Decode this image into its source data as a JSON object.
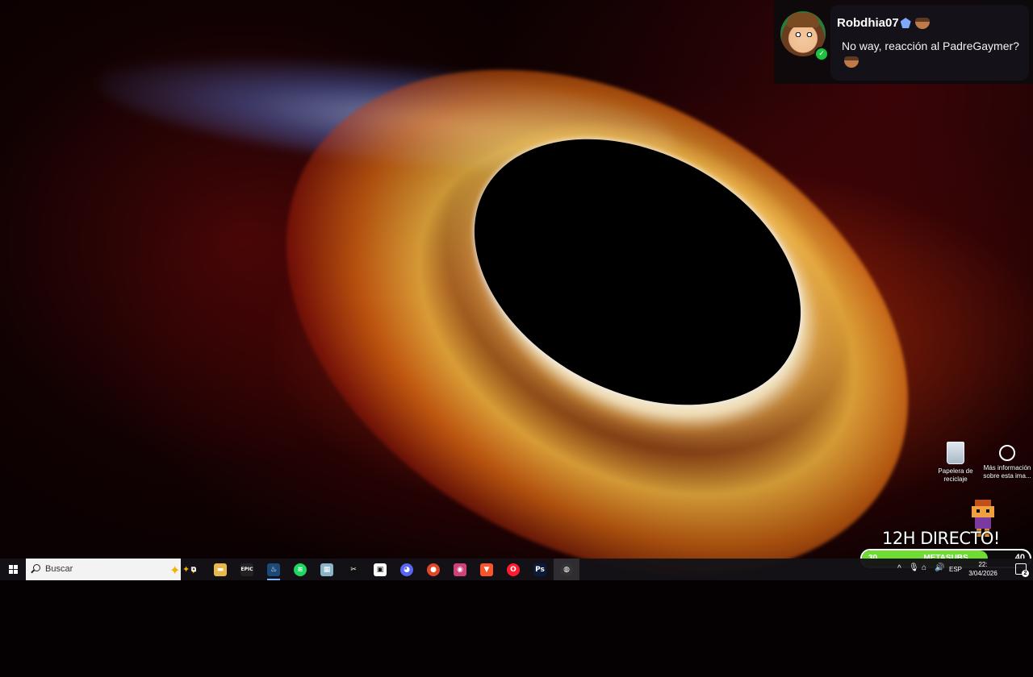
{
  "chat": {
    "username": "Robdhia07",
    "message": "No way, reacción al PadreGaymer?",
    "badge_icon": "gem-badge-icon",
    "emote_icon": "pot-emote-icon",
    "status_icon": "online-status-icon"
  },
  "desktop": {
    "icons": [
      {
        "label": "Papelera de reciclaje",
        "icon": "recycle-bin-icon"
      },
      {
        "label": "Más información sobre esta ima...",
        "icon": "info-icon"
      }
    ]
  },
  "overlay": {
    "title": "12H DIRECTO!",
    "goal": {
      "label": "METASUBS",
      "current": "30",
      "target": "40",
      "fraction": 0.75,
      "color": "#6fdc34"
    }
  },
  "taskbar": {
    "search_placeholder": "Buscar",
    "apps": [
      {
        "name": "task-view",
        "glyph": "⧉",
        "color": "transparent"
      },
      {
        "name": "file-explorer",
        "glyph": "▬",
        "color": "#e8b84a"
      },
      {
        "name": "epic-games",
        "glyph": "EPIC",
        "color": "#222"
      },
      {
        "name": "steam",
        "glyph": "♨",
        "color": "#1b4a7a"
      },
      {
        "name": "spotify",
        "glyph": "≋",
        "color": "#1ed760"
      },
      {
        "name": "notes-app",
        "glyph": "▦",
        "color": "#8ab4c8"
      },
      {
        "name": "capcut",
        "glyph": "✂",
        "color": "#111"
      },
      {
        "name": "roblox-app",
        "glyph": "▣",
        "color": "#fff"
      },
      {
        "name": "discord",
        "glyph": "◕",
        "color": "#5865f2"
      },
      {
        "name": "media-app",
        "glyph": "●",
        "color": "#e0462a"
      },
      {
        "name": "camera-app",
        "glyph": "◉",
        "color": "#d0407a"
      },
      {
        "name": "brave",
        "glyph": "▼",
        "color": "#fb542b"
      },
      {
        "name": "opera",
        "glyph": "O",
        "color": "#ff1b2d"
      },
      {
        "name": "photoshop",
        "glyph": "Ps",
        "color": "#0b1a3a"
      },
      {
        "name": "obs",
        "glyph": "◍",
        "color": "#333"
      }
    ],
    "tray": {
      "language": "ESP",
      "time": "22:",
      "date": "3/04/2026",
      "notifications": "2"
    }
  }
}
